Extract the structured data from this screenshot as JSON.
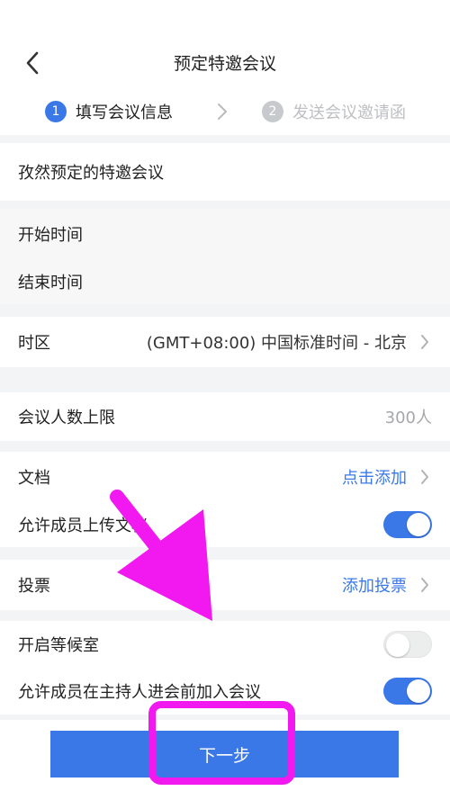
{
  "header": {
    "title": "预定特邀会议",
    "back_icon": "chevron-left-icon"
  },
  "steps": [
    {
      "num": "1",
      "label": "填写会议信息",
      "active": true
    },
    {
      "num": "2",
      "label": "发送会议邀请函",
      "active": false
    }
  ],
  "form": {
    "topic": "孜然预定的特邀会议",
    "start_time_label": "开始时间",
    "end_time_label": "结束时间",
    "timezone_label": "时区",
    "timezone_value": "(GMT+08:00) 中国标准时间 - 北京",
    "capacity_label": "会议人数上限",
    "capacity_value": "300人",
    "docs_label": "文档",
    "docs_action": "点击添加",
    "allow_upload_label": "允许成员上传文档",
    "allow_upload_on": true,
    "vote_label": "投票",
    "vote_action": "添加投票",
    "waiting_room_label": "开启等候室",
    "waiting_room_on": false,
    "join_before_host_label": "允许成员在主持人进会前加入会议",
    "join_before_host_on": true
  },
  "footer": {
    "next_label": "下一步"
  },
  "colors": {
    "accent": "#3a78e8",
    "annotation": "#f218f0",
    "muted": "#bdbfc2"
  }
}
